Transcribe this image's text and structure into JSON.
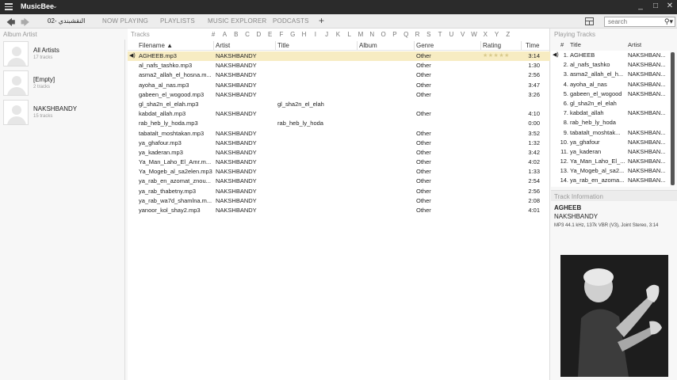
{
  "app": {
    "title": "MusicBee",
    "caret": "⌄"
  },
  "window_controls": {
    "minimize": "_",
    "maximize": "□",
    "close": "✕"
  },
  "toolbar": {
    "back": "🡄",
    "forward": "🡆",
    "tabs": [
      {
        "label": "02- النقشبندي"
      },
      {
        "label": "NOW PLAYING"
      },
      {
        "label": "PLAYLISTS"
      },
      {
        "label": "MUSIC EXPLORER"
      },
      {
        "label": "PODCASTS"
      }
    ],
    "add_tab": "+",
    "search_placeholder": "search"
  },
  "left": {
    "header": "Album Artist",
    "artists": [
      {
        "name": "All Artists",
        "count": "17 tracks"
      },
      {
        "name": "[Empty]",
        "count": "2 tracks"
      },
      {
        "name": "NAKSHBANDY",
        "count": "15 tracks"
      }
    ]
  },
  "tracks": {
    "header": "Tracks",
    "alphabet": [
      "#",
      "A",
      "B",
      "C",
      "D",
      "E",
      "F",
      "G",
      "H",
      "I",
      "J",
      "K",
      "L",
      "M",
      "N",
      "O",
      "P",
      "Q",
      "R",
      "S",
      "T",
      "U",
      "V",
      "W",
      "X",
      "Y",
      "Z"
    ],
    "columns": {
      "filename": "Filename ▲",
      "artist": "Artist",
      "title": "Title",
      "album": "Album",
      "genre": "Genre",
      "rating": "Rating",
      "time": "Time"
    },
    "rows": [
      {
        "play": "◀)",
        "file": "AGHEEB.mp3",
        "artist": "NAKSHBANDY",
        "title": "",
        "album": "",
        "genre": "Other",
        "rating": "★★★★★",
        "time": "3:14"
      },
      {
        "play": "",
        "file": "al_nafs_tashko.mp3",
        "artist": "NAKSHBANDY",
        "title": "",
        "album": "",
        "genre": "Other",
        "rating": "",
        "time": "1:30"
      },
      {
        "play": "",
        "file": "asma2_allah_el_hosna.m...",
        "artist": "NAKSHBANDY",
        "title": "",
        "album": "",
        "genre": "Other",
        "rating": "",
        "time": "2:56"
      },
      {
        "play": "",
        "file": "ayoha_al_nas.mp3",
        "artist": "NAKSHBANDY",
        "title": "",
        "album": "",
        "genre": "Other",
        "rating": "",
        "time": "3:47"
      },
      {
        "play": "",
        "file": "gabeen_el_wogood.mp3",
        "artist": "NAKSHBANDY",
        "title": "",
        "album": "",
        "genre": "Other",
        "rating": "",
        "time": "3:26"
      },
      {
        "play": "",
        "file": "gl_sha2n_el_elah.mp3",
        "artist": "",
        "title": "gl_sha2n_el_elah",
        "album": "",
        "genre": "",
        "rating": "",
        "time": ""
      },
      {
        "play": "",
        "file": "kabdat_allah.mp3",
        "artist": "NAKSHBANDY",
        "title": "",
        "album": "",
        "genre": "Other",
        "rating": "",
        "time": "4:10"
      },
      {
        "play": "",
        "file": "rab_heb_ly_hoda.mp3",
        "artist": "",
        "title": "rab_heb_ly_hoda",
        "album": "",
        "genre": "",
        "rating": "",
        "time": "0:00"
      },
      {
        "play": "",
        "file": "tabatalt_moshtakan.mp3",
        "artist": "NAKSHBANDY",
        "title": "",
        "album": "",
        "genre": "Other",
        "rating": "",
        "time": "3:52"
      },
      {
        "play": "",
        "file": "ya_ghafour.mp3",
        "artist": "NAKSHBANDY",
        "title": "",
        "album": "",
        "genre": "Other",
        "rating": "",
        "time": "1:32"
      },
      {
        "play": "",
        "file": "ya_kaderan.mp3",
        "artist": "NAKSHBANDY",
        "title": "",
        "album": "",
        "genre": "Other",
        "rating": "",
        "time": "3:42"
      },
      {
        "play": "",
        "file": "Ya_Man_Laho_El_Amr.m...",
        "artist": "NAKSHBANDY",
        "title": "",
        "album": "",
        "genre": "Other",
        "rating": "",
        "time": "4:02"
      },
      {
        "play": "",
        "file": "Ya_Mogeb_al_sa2elen.mp3",
        "artist": "NAKSHBANDY",
        "title": "",
        "album": "",
        "genre": "Other",
        "rating": "",
        "time": "1:33"
      },
      {
        "play": "",
        "file": "ya_rab_en_azomat_znou...",
        "artist": "NAKSHBANDY",
        "title": "",
        "album": "",
        "genre": "Other",
        "rating": "",
        "time": "2:54"
      },
      {
        "play": "",
        "file": "ya_rab_thabetny.mp3",
        "artist": "NAKSHBANDY",
        "title": "",
        "album": "",
        "genre": "Other",
        "rating": "",
        "time": "2:56"
      },
      {
        "play": "",
        "file": "ya_rab_wa7d_shamlna.m...",
        "artist": "NAKSHBANDY",
        "title": "",
        "album": "",
        "genre": "Other",
        "rating": "",
        "time": "2:08"
      },
      {
        "play": "",
        "file": "yanoor_kol_shay2.mp3",
        "artist": "NAKSHBANDY",
        "title": "",
        "album": "",
        "genre": "Other",
        "rating": "",
        "time": "4:01"
      }
    ]
  },
  "now_playing": {
    "header": "Playing Tracks",
    "columns": {
      "num": "#",
      "title": "Title",
      "artist": "Artist"
    },
    "rows": [
      {
        "icon": "◀)",
        "num": "1.",
        "title": "AGHEEB",
        "artist": "NAKSHBAN..."
      },
      {
        "icon": "",
        "num": "2.",
        "title": "al_nafs_tashko",
        "artist": "NAKSHBAN..."
      },
      {
        "icon": "",
        "num": "3.",
        "title": "asma2_allah_el_h...",
        "artist": "NAKSHBAN..."
      },
      {
        "icon": "",
        "num": "4.",
        "title": "ayoha_al_nas",
        "artist": "NAKSHBAN..."
      },
      {
        "icon": "",
        "num": "5.",
        "title": "gabeen_el_wogood",
        "artist": "NAKSHBAN..."
      },
      {
        "icon": "",
        "num": "6.",
        "title": "gl_sha2n_el_elah",
        "artist": ""
      },
      {
        "icon": "",
        "num": "7.",
        "title": "kabdat_allah",
        "artist": "NAKSHBAN..."
      },
      {
        "icon": "",
        "num": "8.",
        "title": "rab_heb_ly_hoda",
        "artist": ""
      },
      {
        "icon": "",
        "num": "9.",
        "title": "tabatalt_moshtak...",
        "artist": "NAKSHBAN..."
      },
      {
        "icon": "",
        "num": "10.",
        "title": "ya_ghafour",
        "artist": "NAKSHBAN..."
      },
      {
        "icon": "",
        "num": "11.",
        "title": "ya_kaderan",
        "artist": "NAKSHBAN..."
      },
      {
        "icon": "",
        "num": "12.",
        "title": "Ya_Man_Laho_El_...",
        "artist": "NAKSHBAN..."
      },
      {
        "icon": "",
        "num": "13.",
        "title": "Ya_Mogeb_al_sa2...",
        "artist": "NAKSHBAN..."
      },
      {
        "icon": "",
        "num": "14.",
        "title": "ya_rab_en_azoma...",
        "artist": "NAKSHBAN..."
      }
    ]
  },
  "track_info": {
    "header": "Track Information",
    "title": "AGHEEB",
    "artist": "NAKSHBANDY",
    "format": "MP3 44.1 kHz, 137k VBR (V3), Joint Stereo, 3:14"
  },
  "colors": {
    "playing_row": "#f7ecc2",
    "titlebar": "#2b2b2b",
    "rating_star": "#d8c98a"
  }
}
